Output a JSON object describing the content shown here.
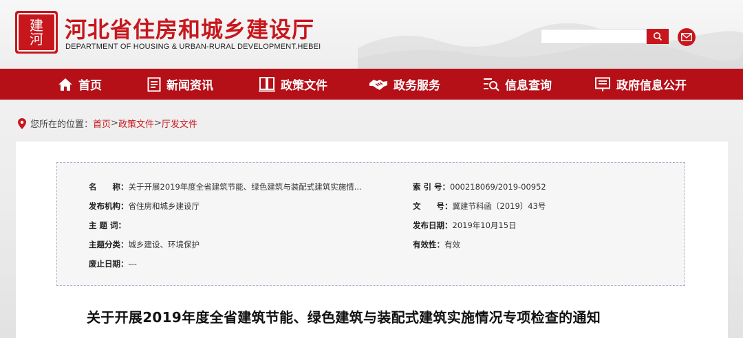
{
  "header": {
    "title": "河北省住房和城乡建设厅",
    "subtitle": "DEPARTMENT OF HOUSING & URBAN-RURAL DEVELOPMENT.HEBEI",
    "search_placeholder": ""
  },
  "nav": {
    "items": [
      {
        "label": "首页",
        "icon": "home-icon"
      },
      {
        "label": "新闻资讯",
        "icon": "news-icon"
      },
      {
        "label": "政策文件",
        "icon": "book-icon"
      },
      {
        "label": "政务服务",
        "icon": "handshake-icon"
      },
      {
        "label": "信息查询",
        "icon": "search-list-icon"
      },
      {
        "label": "政府信息公开",
        "icon": "notice-board-icon"
      }
    ]
  },
  "breadcrumb": {
    "prefix": "您所在的位置：",
    "items": [
      "首页",
      "政策文件",
      "厅发文件"
    ],
    "separator": ">"
  },
  "meta": {
    "name_label": "名　　称：",
    "name_value": "关于开展2019年度全省建筑节能、绿色建筑与装配式建筑实施情...",
    "index_label": "索 引 号：",
    "index_value": "000218069/2019-00952",
    "publisher_label": "发布机构：",
    "publisher_value": "省住房和城乡建设厅",
    "docno_label": "文　　号：",
    "docno_value": "冀建节科函〔2019〕43号",
    "keywords_label": "主 题 词：",
    "keywords_value": "",
    "date_label": "发布日期：",
    "date_value": "2019年10月15日",
    "category_label": "主题分类：",
    "category_value": "城乡建设、环境保护",
    "validity_label": "有效性：",
    "validity_value": "有效",
    "repeal_label": "废止日期：",
    "repeal_value": "---"
  },
  "document": {
    "title": "关于开展2019年度全省建筑节能、绿色建筑与装配式建筑实施情况专项检查的通知"
  },
  "colors": {
    "brand_red": "#c8161d",
    "nav_red": "#b50f18"
  }
}
